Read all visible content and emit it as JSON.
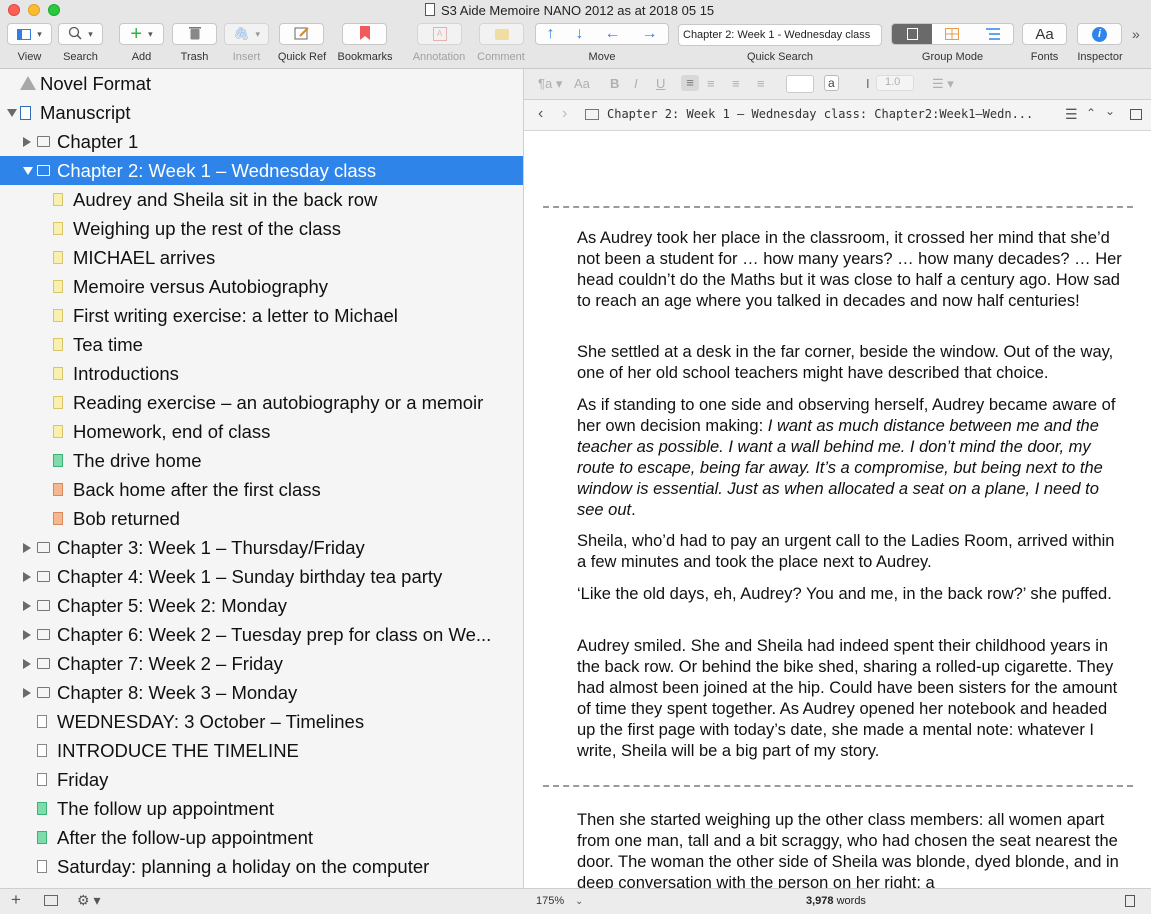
{
  "window": {
    "title": "S3 Aide Memoire NANO 2012 as at 2018 05 15"
  },
  "toolbar": {
    "view": "View",
    "search": "Search",
    "add": "Add",
    "trash": "Trash",
    "insert": "Insert",
    "quick_ref": "Quick Ref",
    "bookmarks": "Bookmarks",
    "annotation": "Annotation",
    "comment": "Comment",
    "move": "Move",
    "quick_search_label": "Quick Search",
    "quick_search_value": "Chapter 2: Week 1 - Wednesday class",
    "group_mode": "Group Mode",
    "fonts": "Fonts",
    "fonts_glyph": "Aa",
    "inspector": "Inspector",
    "overflow": "»"
  },
  "binder": {
    "items": [
      {
        "label": "Novel Format",
        "icon": "warning-icon"
      },
      {
        "label": "Manuscript",
        "icon": "manuscript-icon"
      },
      {
        "label": "Chapter 1",
        "icon": "folder-icon"
      },
      {
        "label": "Chapter 2: Week 1 – Wednesday class",
        "icon": "folder-icon",
        "selected": true
      },
      {
        "label": "Audrey and Sheila sit in the back row",
        "icon": "doc-yellow-icon"
      },
      {
        "label": "Weighing up the rest of the class",
        "icon": "doc-yellow-icon"
      },
      {
        "label": "MICHAEL arrives",
        "icon": "doc-yellow-icon"
      },
      {
        "label": "Memoire versus Autobiography",
        "icon": "doc-yellow-icon"
      },
      {
        "label": "First writing exercise: a letter to Michael",
        "icon": "doc-yellow-icon"
      },
      {
        "label": "Tea time",
        "icon": "doc-yellow-icon"
      },
      {
        "label": "Introductions",
        "icon": "doc-yellow-icon"
      },
      {
        "label": "Reading exercise – an autobiography or a memoir",
        "icon": "doc-yellow-icon"
      },
      {
        "label": "Homework, end of class",
        "icon": "doc-yellow-icon"
      },
      {
        "label": "The drive home",
        "icon": "doc-green-icon"
      },
      {
        "label": "Back home after the first class",
        "icon": "doc-orange-icon"
      },
      {
        "label": "Bob returned",
        "icon": "doc-orange-icon"
      },
      {
        "label": "Chapter 3: Week 1 – Thursday/Friday",
        "icon": "folder-icon"
      },
      {
        "label": "Chapter 4: Week 1 – Sunday birthday tea party",
        "icon": "folder-icon"
      },
      {
        "label": "Chapter 5: Week 2: Monday",
        "icon": "folder-icon"
      },
      {
        "label": "Chapter 6: Week 2 – Tuesday prep for class on We...",
        "icon": "folder-icon"
      },
      {
        "label": "Chapter 7: Week 2 – Friday",
        "icon": "folder-icon"
      },
      {
        "label": "Chapter 8: Week 3 – Monday",
        "icon": "folder-icon"
      },
      {
        "label": "WEDNESDAY: 3 October – Timelines",
        "icon": "doc-icon"
      },
      {
        "label": "INTRODUCE THE TIMELINE",
        "icon": "doc-icon"
      },
      {
        "label": "Friday",
        "icon": "doc-icon"
      },
      {
        "label": "The follow up appointment",
        "icon": "doc-green-icon"
      },
      {
        "label": "After the follow-up appointment",
        "icon": "doc-green-icon"
      },
      {
        "label": "Saturday: planning a holiday on the computer",
        "icon": "doc-icon"
      }
    ]
  },
  "format_bar": {
    "align": "Aa",
    "font_size": "a",
    "line_spacing": "1.0"
  },
  "editor_header": {
    "path": "Chapter 2: Week 1 – Wednesday class: Chapter2:Week1–Wedn..."
  },
  "editor": {
    "paragraphs": [
      "As Audrey took her place in the classroom, it crossed her mind that she’d not been a student for … how many years? … how many decades? … Her head couldn’t do the Maths but it was close to half a century ago. How sad to reach an age where you talked in decades and now half centuries!",
      "She settled at a desk in the far corner, beside the window. Out of the way, one of her old school teachers might have described that choice.",
      "As if standing to one side and observing herself, Audrey became aware of her own decision making:",
      "Sheila, who’d had to pay an urgent call to the Ladies Room, arrived within a few minutes and took the place next to Audrey.",
      "‘Like the old days, eh, Audrey? You and me, in the back row?’ she puffed.",
      "Audrey smiled. She and Sheila had indeed spent their childhood years in the back row. Or behind the bike shed, sharing a rolled-up cigarette. They had almost been joined at the hip. Could have been sisters for the amount of time they spent together. As Audrey opened her notebook and headed up the first page with today’s date, she made a mental note: whatever I write, Sheila will be a big part of my story.",
      "Then she started weighing up the other class members: all women apart from one man, tall and a bit scraggy, who had chosen the seat nearest the door. The woman the other side of Sheila was blonde, dyed blonde, and in deep conversation with the person on her right: a"
    ],
    "italic": "I want as much distance between me and the teacher as possible. I want a wall behind me. I don’t mind the door, my route to escape, being far away. It’s a compromise, but being next to the window is essential. Just as when allocated a seat on a plane, I need to see out",
    "italic_end": "."
  },
  "footer": {
    "zoom": "175%",
    "word_count": "3,978",
    "words_label": "words"
  }
}
